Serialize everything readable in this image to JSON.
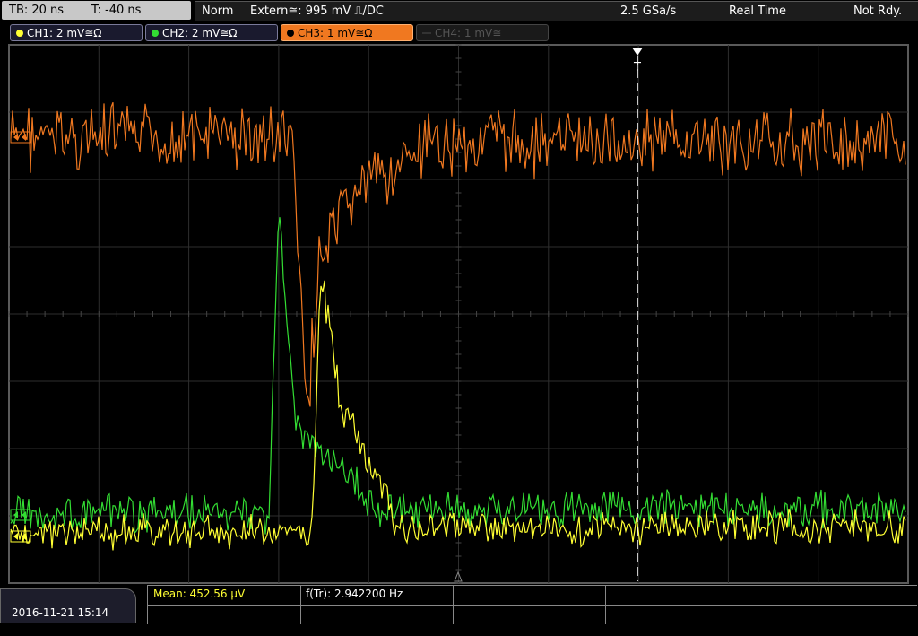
{
  "top_bar": {
    "timebase": "TB: 20 ns",
    "trigger_offset": "T: -40 ns",
    "trigger_mode": "Norm",
    "trigger_source": "Extern≅: 995 mV ⎍/DC",
    "sample_rate": "2.5 GSa/s",
    "acquisition_mode": "Real Time",
    "status": "Not Rdy."
  },
  "channels": [
    {
      "label": "CH1: 2 mV≅Ω",
      "color": "#ffff33",
      "state": "off"
    },
    {
      "label": "CH2: 2 mV≅Ω",
      "color": "#33dd33",
      "state": "off"
    },
    {
      "label": "CH3: 1 mV≅Ω",
      "color": "#f07820",
      "state": "selected"
    },
    {
      "label": "CH4: 1 mV≅",
      "color": "#555555",
      "state": "disabled"
    }
  ],
  "display": {
    "trigger_marker": "T",
    "colors": {
      "grid": "#2e2e2e",
      "ch1": "#ffff33",
      "ch2": "#33dd33",
      "ch3": "#f07820",
      "trigger": "#ffffff"
    }
  },
  "bottom": {
    "datetime": "2016-11-21 15:14",
    "measurements": [
      {
        "label": "Mean: 452.56 µV",
        "color": "#ffff33"
      },
      {
        "label": "f(Tr): 2.942200 Hz",
        "color": "#ffffff"
      }
    ]
  }
}
